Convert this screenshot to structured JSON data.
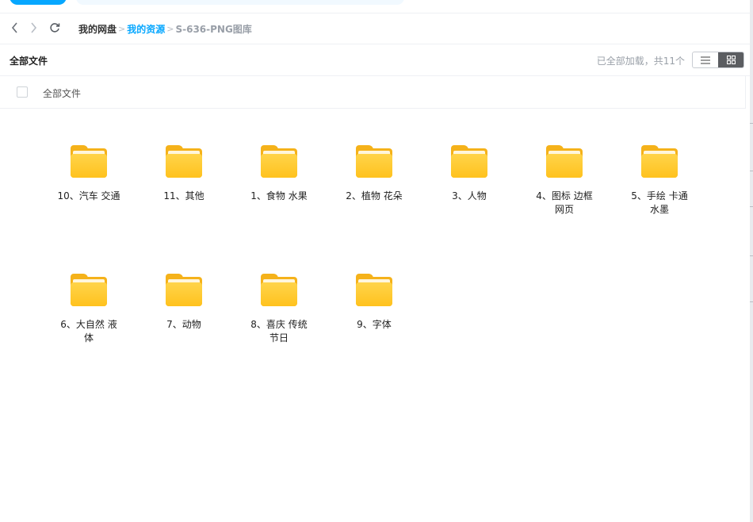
{
  "nav": {
    "breadcrumb": [
      "我的网盘",
      "我的资源",
      "S-636-PNG图库"
    ],
    "separator": ">"
  },
  "toolbar": {
    "title": "全部文件",
    "status": "已全部加载，共11个"
  },
  "list_header": {
    "label": "全部文件"
  },
  "folders": [
    {
      "name": "10、汽车 交通"
    },
    {
      "name": "11、其他"
    },
    {
      "name": "1、食物 水果"
    },
    {
      "name": "2、植物 花朵"
    },
    {
      "name": "3、人物"
    },
    {
      "name": "4、图标 边框 网页"
    },
    {
      "name": "5、手绘 卡通 水墨"
    },
    {
      "name": "6、大自然 液体"
    },
    {
      "name": "7、动物"
    },
    {
      "name": "8、喜庆 传统 节日"
    },
    {
      "name": "9、字体"
    }
  ],
  "colors": {
    "accent": "#06a7ff",
    "folder": "#ffc21e",
    "active_toggle": "#5b5d61"
  }
}
